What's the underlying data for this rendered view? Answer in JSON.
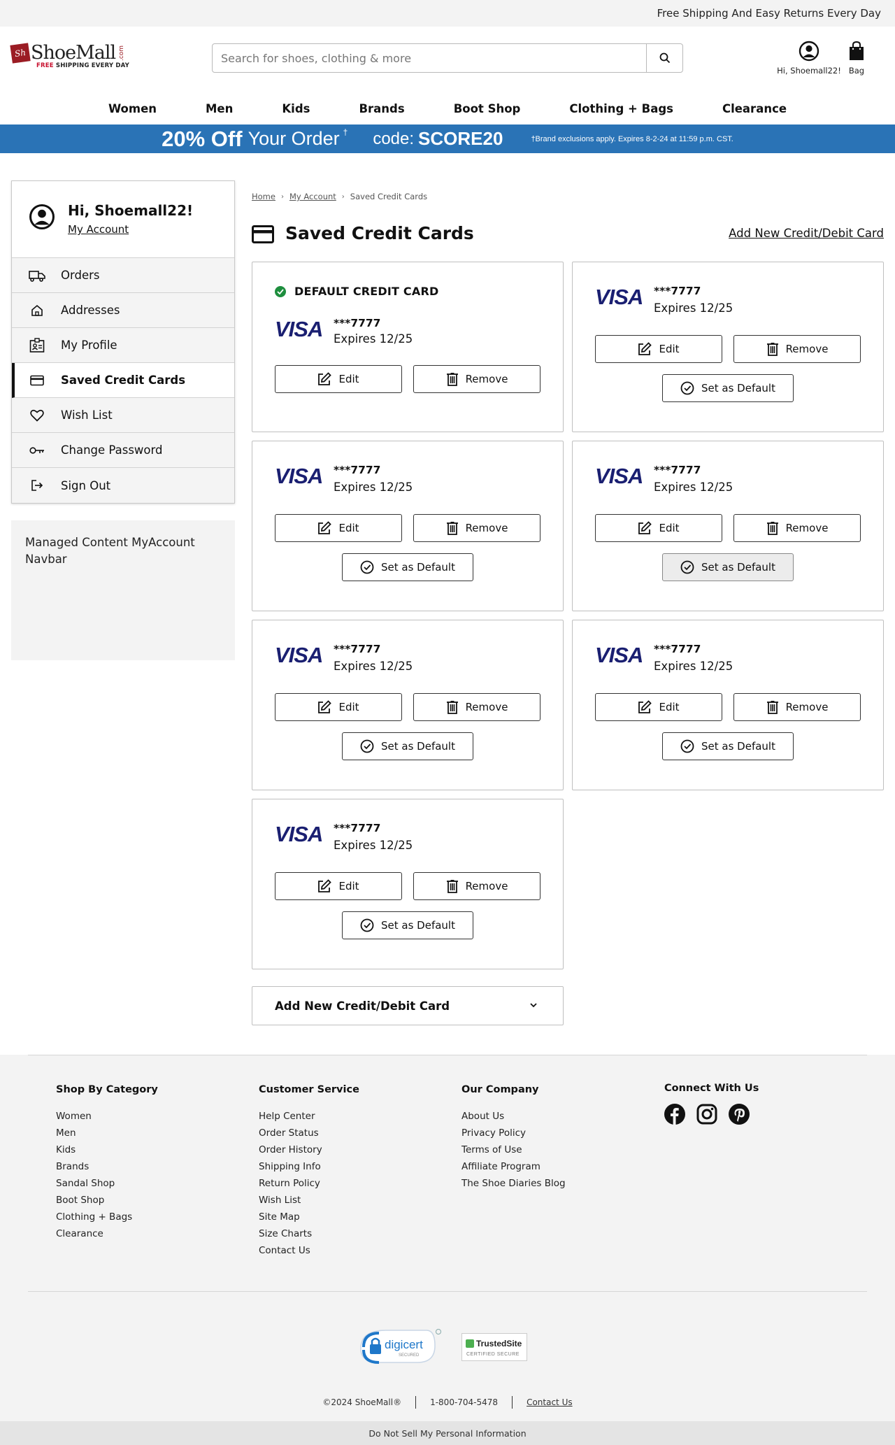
{
  "topstrip": {
    "text": "Free Shipping And Easy Returns Every Day"
  },
  "header": {
    "logo": {
      "mark": "Sh",
      "name": "ShoeMall",
      "com": ".com",
      "tag_red": "FREE",
      "tag_rest": " SHIPPING EVERY DAY"
    },
    "search": {
      "placeholder": "Search for shoes, clothing & more",
      "value": ""
    },
    "account_label": "Hi, Shoemall22!",
    "bag_label": "Bag"
  },
  "nav": [
    "Women",
    "Men",
    "Kids",
    "Brands",
    "Boot Shop",
    "Clothing + Bags",
    "Clearance"
  ],
  "promo": {
    "big": "20% Off",
    "mid": "Your Order",
    "dagger": "†",
    "code_label": "code:",
    "code": "SCORE20",
    "fine": "†Brand exclusions apply. Expires 8-2-24 at 11:59 p.m. CST."
  },
  "sidebar": {
    "greeting": "Hi, Shoemall22!",
    "my_account": "My Account",
    "items": [
      {
        "label": "Orders",
        "icon": "truck-icon"
      },
      {
        "label": "Addresses",
        "icon": "home-icon"
      },
      {
        "label": "My Profile",
        "icon": "profile-card-icon"
      },
      {
        "label": "Saved Credit Cards",
        "icon": "credit-card-icon",
        "active": true
      },
      {
        "label": "Wish List",
        "icon": "heart-icon"
      },
      {
        "label": "Change Password",
        "icon": "key-icon"
      },
      {
        "label": "Sign Out",
        "icon": "sign-out-icon"
      }
    ],
    "managed": "Managed Content MyAccount Navbar"
  },
  "breadcrumb": [
    "Home",
    "My Account",
    "Saved Credit Cards"
  ],
  "page": {
    "title": "Saved Credit Cards",
    "add_link": "Add New Credit/Debit Card",
    "default_label": "DEFAULT CREDIT CARD",
    "edit_label": "Edit",
    "remove_label": "Remove",
    "set_default_label": "Set as Default",
    "add_accordion": "Add New Credit/Debit Card"
  },
  "cards": [
    {
      "brand": "VISA",
      "number": "***7777",
      "expires": "Expires 12/25",
      "default": true
    },
    {
      "brand": "VISA",
      "number": "***7777",
      "expires": "Expires 12/25",
      "default": false
    },
    {
      "brand": "VISA",
      "number": "***7777",
      "expires": "Expires 12/25",
      "default": false
    },
    {
      "brand": "VISA",
      "number": "***7777",
      "expires": "Expires 12/25",
      "default": false
    },
    {
      "brand": "VISA",
      "number": "***7777",
      "expires": "Expires 12/25",
      "default": false
    },
    {
      "brand": "VISA",
      "number": "***7777",
      "expires": "Expires 12/25",
      "default": false
    },
    {
      "brand": "VISA",
      "number": "***7777",
      "expires": "Expires 12/25",
      "default": false
    }
  ],
  "footer": {
    "shop": {
      "title": "Shop By Category",
      "links": [
        "Women",
        "Men",
        "Kids",
        "Brands",
        "Sandal Shop",
        "Boot Shop",
        "Clothing + Bags",
        "Clearance"
      ]
    },
    "service": {
      "title": "Customer Service",
      "links": [
        "Help Center",
        "Order Status",
        "Order History",
        "Shipping Info",
        "Return Policy",
        "Wish List",
        "Site Map",
        "Size Charts",
        "Contact Us"
      ]
    },
    "company": {
      "title": "Our Company",
      "links": [
        "About Us",
        "Privacy Policy",
        "Terms of Use",
        "Affiliate Program",
        "The Shoe Diaries Blog"
      ]
    },
    "connect": {
      "title": "Connect With Us",
      "icons": [
        "facebook-icon",
        "instagram-icon",
        "pinterest-icon"
      ]
    },
    "seal1": {
      "name": "digicert",
      "sub": "SECURED"
    },
    "seal2": {
      "name": "TrustedSite",
      "sub": "CERTIFIED SECURE"
    },
    "copyright": "©2024 ShoeMall®",
    "phone": "1-800-704-5478",
    "contact": "Contact Us",
    "dnsmpi": "Do Not Sell My Personal Information"
  },
  "colors": {
    "promo_blue": "#2a73b6",
    "visa_blue": "#1434cb",
    "default_green": "#1e8e3e",
    "brand_red": "#9b1c24"
  }
}
